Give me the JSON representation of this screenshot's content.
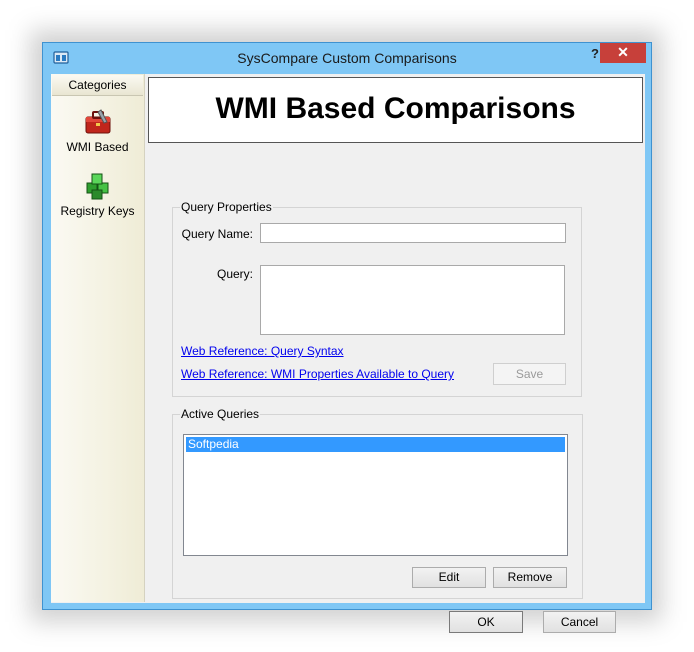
{
  "window": {
    "title": "SysCompare Custom Comparisons",
    "help_label": "?",
    "close_label": "✕"
  },
  "sidebar": {
    "header": "Categories",
    "items": [
      {
        "label": "WMI Based",
        "icon": "toolbox-icon"
      },
      {
        "label": "Registry Keys",
        "icon": "registry-cubes-icon"
      }
    ]
  },
  "banner": {
    "title": "WMI Based Comparisons"
  },
  "query_properties": {
    "group_title": "Query Properties",
    "name_label": "Query Name:",
    "name_value": "",
    "query_label": "Query:",
    "query_value": "",
    "link_syntax": "Web Reference: Query Syntax",
    "link_properties": "Web Reference: WMI Properties Available to Query",
    "save_label": "Save"
  },
  "active_queries": {
    "group_title": "Active Queries",
    "items": [
      "Softpedia"
    ],
    "edit_label": "Edit",
    "remove_label": "Remove"
  },
  "footer": {
    "ok_label": "OK",
    "cancel_label": "Cancel"
  },
  "colors": {
    "titlebar": "#7fc7f5",
    "close": "#c7403a",
    "selection": "#3399ff",
    "link": "#0000ee"
  }
}
